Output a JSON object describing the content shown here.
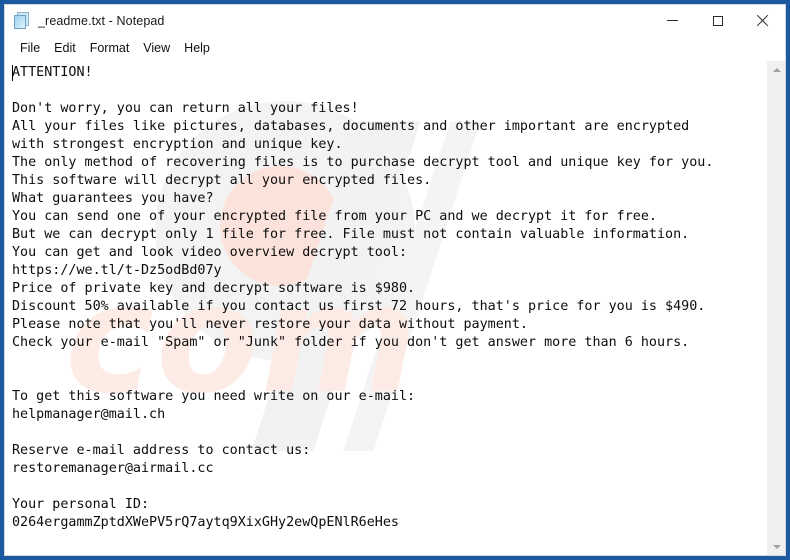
{
  "window": {
    "title": "_readme.txt - Notepad",
    "icon": "notepad-document-icon",
    "controls": {
      "minimize": "minimize",
      "maximize": "maximize",
      "close": "close"
    }
  },
  "menubar": {
    "items": [
      {
        "label": "File"
      },
      {
        "label": "Edit"
      },
      {
        "label": "Format"
      },
      {
        "label": "View"
      },
      {
        "label": "Help"
      }
    ]
  },
  "document": {
    "filename": "_readme.txt",
    "body": "ATTENTION!\n\nDon't worry, you can return all your files!\nAll your files like pictures, databases, documents and other important are encrypted\nwith strongest encryption and unique key.\nThe only method of recovering files is to purchase decrypt tool and unique key for you.\nThis software will decrypt all your encrypted files.\nWhat guarantees you have?\nYou can send one of your encrypted file from your PC and we decrypt it for free.\nBut we can decrypt only 1 file for free. File must not contain valuable information.\nYou can get and look video overview decrypt tool:\nhttps://we.tl/t-Dz5odBd07y\nPrice of private key and decrypt software is $980.\nDiscount 50% available if you contact us first 72 hours, that's price for you is $490.\nPlease note that you'll never restore your data without payment.\nCheck your e-mail \"Spam\" or \"Junk\" folder if you don't get answer more than 6 hours.\n\n\nTo get this software you need write on our e-mail:\nhelpmanager@mail.ch\n\nReserve e-mail address to contact us:\nrestoremanager@airmail.cc\n\nYour personal ID:\n0264ergammZptdXWePV5rQ7aytq9XixGHy2ewQpENlR6eHes",
    "video_url": "https://we.tl/t-Dz5odBd07y",
    "price_full": "$980",
    "price_discounted": "$490",
    "discount_percent": "50%",
    "discount_window_hours": "72 hours",
    "response_time_hours": "6 hours",
    "primary_email": "helpmanager@mail.ch",
    "reserve_email": "restoremanager@airmail.cc",
    "personal_id": "0264ergammZptdXWePV5rQ7aytq9XixGHy2ewQpENlR6eHes"
  },
  "watermark": {
    "text": "com"
  },
  "scrollbar": {
    "up_arrow": "scroll-up",
    "down_arrow": "scroll-down"
  },
  "colors": {
    "desktop_frame": "#1b5a9e",
    "window_bg": "#ffffff",
    "text": "#0d0d0d",
    "scrollbar_track": "#f0f0f0",
    "watermark": "#fdeae4"
  }
}
